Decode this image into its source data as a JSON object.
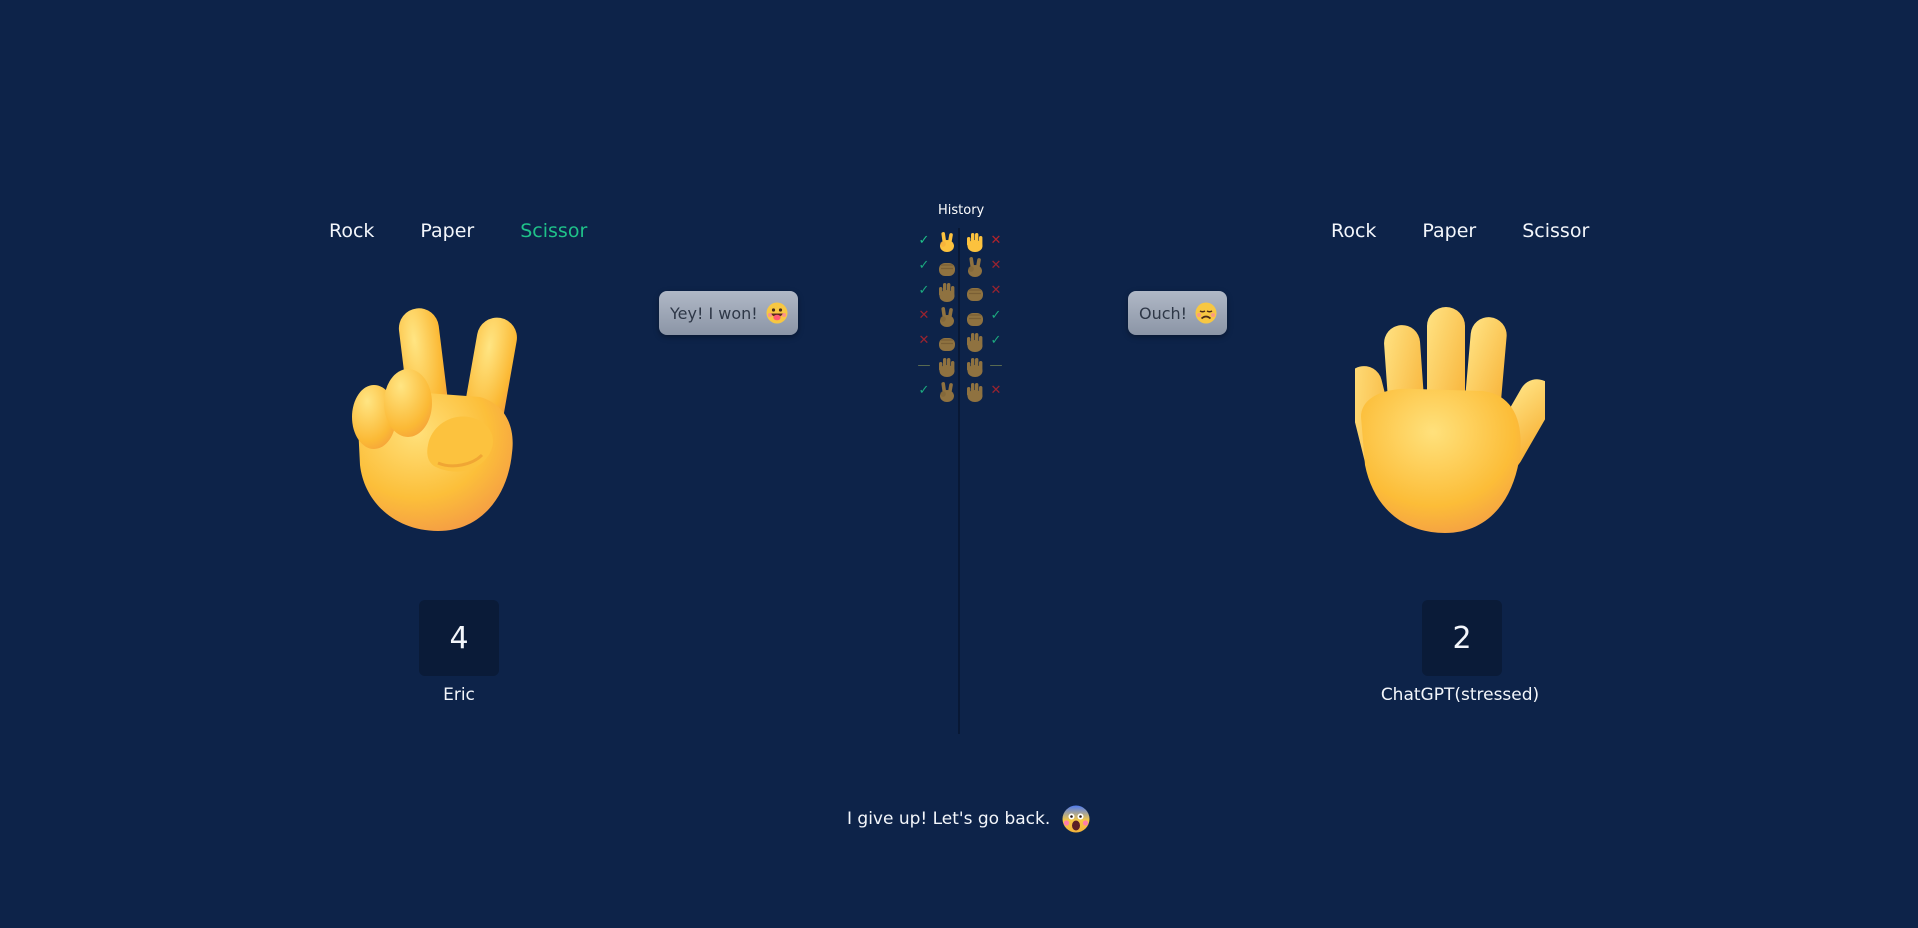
{
  "player": {
    "choices": [
      "Rock",
      "Paper",
      "Scissor"
    ],
    "selected": "Scissor",
    "hand_icon": "victory-hand-icon",
    "bubble_text": "Yey! I won!",
    "bubble_icon": "grinning-tongue-face-icon",
    "score": "4",
    "name": "Eric"
  },
  "opponent": {
    "choices": [
      "Rock",
      "Paper",
      "Scissor"
    ],
    "selected": "Paper",
    "hand_icon": "raised-hand-icon",
    "bubble_text": "Ouch!",
    "bubble_icon": "disappointed-face-icon",
    "score": "2",
    "name": "ChatGPT(stressed)"
  },
  "history": {
    "title": "History",
    "rounds": [
      {
        "player_result": "win",
        "player_move": "scissor",
        "opponent_move": "paper",
        "opponent_result": "lose",
        "highlighted": true
      },
      {
        "player_result": "win",
        "player_move": "rock",
        "opponent_move": "scissor",
        "opponent_result": "lose"
      },
      {
        "player_result": "win",
        "player_move": "paper",
        "opponent_move": "rock",
        "opponent_result": "lose"
      },
      {
        "player_result": "lose",
        "player_move": "scissor",
        "opponent_move": "rock",
        "opponent_result": "win"
      },
      {
        "player_result": "lose",
        "player_move": "rock",
        "opponent_move": "paper",
        "opponent_result": "win"
      },
      {
        "player_result": "draw",
        "player_move": "paper",
        "opponent_move": "paper",
        "opponent_result": "draw"
      },
      {
        "player_result": "win",
        "player_move": "scissor",
        "opponent_move": "paper",
        "opponent_result": "lose"
      }
    ]
  },
  "give_up": {
    "label": "I give up! Let's go back.",
    "icon": "screaming-face-icon"
  },
  "colors": {
    "background": "#0d2349",
    "active_choice": "#1fc189",
    "win": "#1fc189",
    "lose": "#b3232b",
    "draw": "#6b7c52",
    "score_box": "#0a1b38"
  }
}
